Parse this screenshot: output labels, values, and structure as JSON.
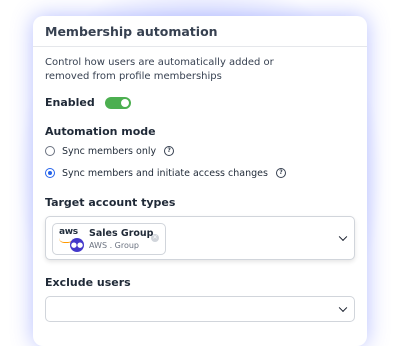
{
  "panel": {
    "title": "Membership automation",
    "description": "Control how users are automatically added or removed from profile memberships",
    "enabled_label": "Enabled",
    "enabled": true
  },
  "automation_mode": {
    "title": "Automation mode",
    "options": [
      {
        "label": "Sync members only",
        "selected": false
      },
      {
        "label": "Sync members and initiate access changes",
        "selected": true
      }
    ]
  },
  "target_account_types": {
    "title": "Target account types",
    "selected_chip": {
      "title": "Sales Group",
      "subtitle": "AWS . Group",
      "logo_text": "aws"
    }
  },
  "exclude_users": {
    "title": "Exclude users",
    "value": ""
  },
  "colors": {
    "toggle_on": "#4caf50",
    "radio_selected": "#2563eb",
    "aws_orange": "#ff9900",
    "group_badge": "#4338ca"
  },
  "icons": {
    "help": "help-circle-icon",
    "chevron": "chevron-down-icon",
    "remove": "remove-chip-icon",
    "group": "group-icon"
  }
}
